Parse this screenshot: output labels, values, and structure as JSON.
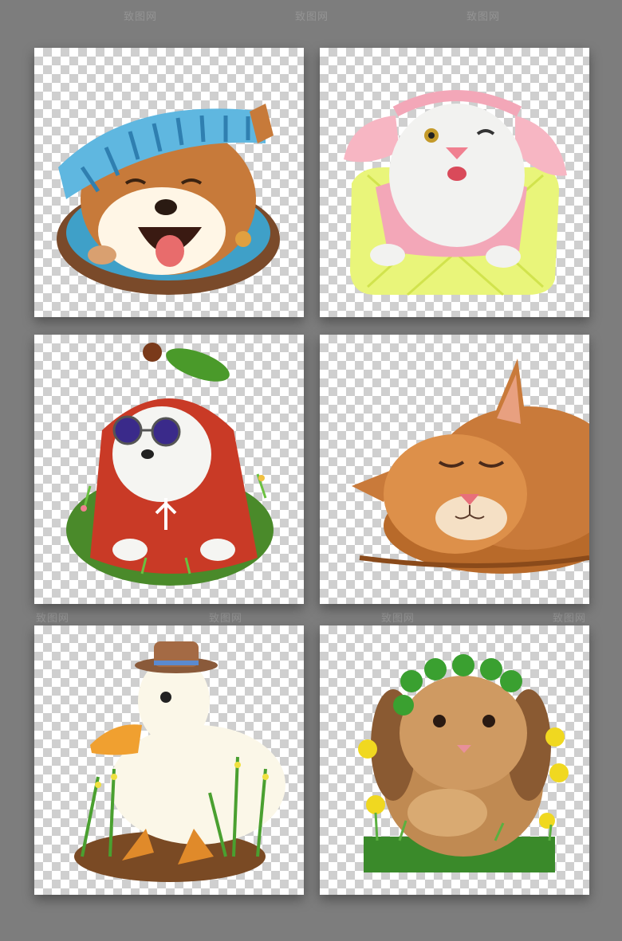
{
  "watermark": {
    "text": "致图网"
  },
  "tiles": [
    {
      "name": "shiba-dog-illustration"
    },
    {
      "name": "cat-bunny-hood-illustration"
    },
    {
      "name": "white-dog-apple-costume-illustration"
    },
    {
      "name": "sleeping-orange-cat-illustration"
    },
    {
      "name": "white-duck-hat-illustration"
    },
    {
      "name": "brown-rabbit-clover-illustration"
    }
  ]
}
